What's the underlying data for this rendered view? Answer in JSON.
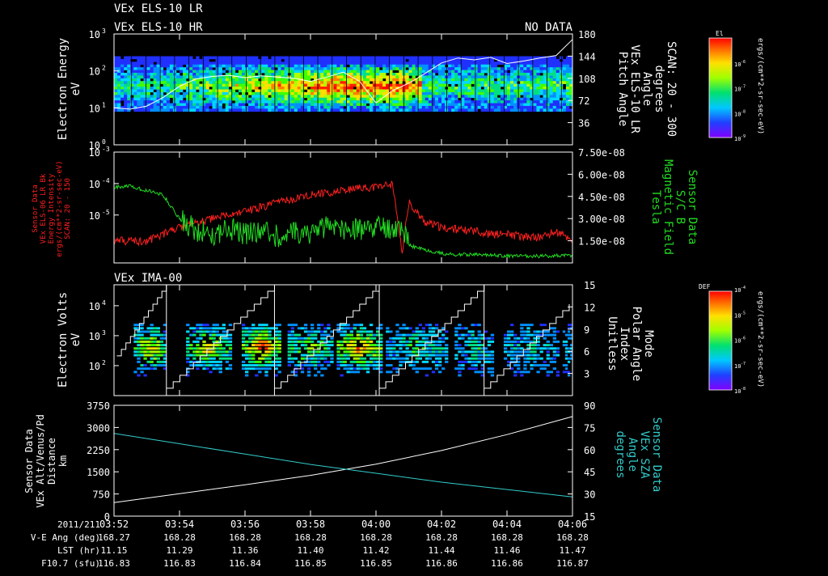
{
  "colors": {
    "background": "#000000",
    "foreground": "#ffffff",
    "red_trace": "#ff2020",
    "green_trace": "#22dd22",
    "cyan_trace": "#33cccc",
    "white_trace": "#ffffff"
  },
  "chart_data": [
    {
      "type": "heatmap",
      "titles": [
        "VEx ELS-10 LR",
        "VEx ELS-10 HR"
      ],
      "annotation": "NO DATA",
      "ylabel": [
        "Electron Energy",
        "eV"
      ],
      "y_scale": "log",
      "ylim": [
        1,
        1000
      ],
      "y_ticks": [
        {
          "base": "10",
          "exp": "0",
          "value": 1
        },
        {
          "base": "10",
          "exp": "1",
          "value": 10
        },
        {
          "base": "10",
          "exp": "2",
          "value": 100
        },
        {
          "base": "10",
          "exp": "3",
          "value": 1000
        }
      ],
      "y2label": [
        "Pitch Angle",
        "VEx ELS-10 LR",
        "Angle",
        "degrees",
        "SCAN: 20 - 300"
      ],
      "y2lim": [
        0,
        180
      ],
      "y2_ticks": [
        "36",
        "72",
        "108",
        "144",
        "180"
      ],
      "colorbar": {
        "title": "El",
        "unit_label": "ergs/(cm**2-sr-sec-eV)",
        "ticks": [
          {
            "base": "10",
            "exp": "-6"
          },
          {
            "base": "10",
            "exp": "-7"
          },
          {
            "base": "10",
            "exp": "-8"
          },
          {
            "base": "10",
            "exp": "-9"
          }
        ]
      },
      "overlay_series": {
        "axis": "right",
        "t": [
          0,
          0.5,
          1,
          1.5,
          2,
          2.5,
          3,
          3.5,
          4,
          4.5,
          5,
          5.5,
          6,
          6.5,
          7,
          7.5,
          8,
          8.5,
          9,
          9.5,
          10,
          10.5,
          11,
          11.5,
          12,
          12.5,
          13,
          13.5,
          14
        ],
        "values": [
          60,
          58,
          63,
          77,
          95,
          107,
          111,
          113,
          109,
          112,
          110,
          108,
          103,
          110,
          118,
          103,
          68,
          88,
          100,
          116,
          133,
          141,
          138,
          142,
          132,
          136,
          141,
          145,
          171
        ]
      }
    },
    {
      "type": "line",
      "ylabel": [
        "Sensor Data",
        "VEx ELS-06 LR Bk",
        "Energy Intensity",
        "ergs/(cm**2-sr-sec-eV)",
        "SCAN: 20 - 150"
      ],
      "y_scale": "log",
      "ylim": [
        3e-07,
        0.001
      ],
      "y_ticks": [
        {
          "base": "10",
          "exp": "-3",
          "value": 0.001
        },
        {
          "base": "10",
          "exp": "-4",
          "value": 0.0001
        },
        {
          "base": "10",
          "exp": "-5",
          "value": 1e-05
        }
      ],
      "y2label": [
        "Sensor Data",
        "S/C B",
        "Magnetic Field",
        "Tesla"
      ],
      "y2lim": [
        0,
        7.5e-08
      ],
      "y2_ticks": [
        "1.50e-08",
        "3.00e-08",
        "4.50e-08",
        "6.00e-08",
        "7.50e-08"
      ],
      "series": [
        {
          "axis": "left",
          "t": [
            0,
            0.5,
            1,
            1.5,
            2,
            2.5,
            3,
            3.5,
            4,
            4.5,
            5,
            5.5,
            6,
            6.5,
            7,
            7.5,
            8,
            8.5,
            8.8,
            9,
            9.5,
            10,
            10.5,
            11,
            11.5,
            12,
            12.5,
            13,
            13.5,
            14
          ],
          "values": [
            1.5e-06,
            1.5e-06,
            1.5e-06,
            2.5e-06,
            4e-06,
            5.5e-06,
            7.5e-06,
            1e-05,
            1.3e-05,
            1.8e-05,
            2.5e-05,
            3.2e-05,
            4.5e-05,
            5e-05,
            6e-05,
            7e-05,
            8e-05,
            9.5e-05,
            6e-07,
            2.5e-05,
            6e-06,
            4e-06,
            3.5e-06,
            3e-06,
            2.5e-06,
            2.5e-06,
            2e-06,
            2e-06,
            3e-06,
            1.6e-06
          ]
        },
        {
          "axis": "right",
          "t": [
            0,
            0.5,
            1,
            1.2,
            1.5,
            2,
            2.5,
            3,
            3.5,
            4,
            4.5,
            5,
            5.5,
            6,
            6.5,
            7,
            7.5,
            8,
            8.5,
            8.8,
            9,
            9.5,
            10,
            10.5,
            11,
            11.5,
            12,
            12.5,
            13,
            13.5,
            14
          ],
          "values": [
            5.1e-08,
            5.2e-08,
            4.9e-08,
            4.8e-08,
            4.6e-08,
            3e-08,
            2.2e-08,
            1.9e-08,
            2.3e-08,
            2e-08,
            2.2e-08,
            1.8e-08,
            2e-08,
            2.1e-08,
            2.4e-08,
            2.3e-08,
            2.2e-08,
            2.6e-08,
            2.4e-08,
            2.6e-08,
            1.2e-08,
            9e-09,
            6.5e-09,
            5.5e-09,
            5.5e-09,
            5e-09,
            5e-09,
            4.5e-09,
            4.5e-09,
            5e-09,
            5e-09
          ]
        }
      ]
    },
    {
      "type": "heatmap",
      "titles": [
        "VEx IMA-00"
      ],
      "ylabel": [
        "Electron Volts",
        "eV"
      ],
      "y_scale": "log",
      "ylim": [
        10,
        50000
      ],
      "y_ticks": [
        {
          "base": "10",
          "exp": "2",
          "value": 100
        },
        {
          "base": "10",
          "exp": "3",
          "value": 1000
        },
        {
          "base": "10",
          "exp": "4",
          "value": 10000
        }
      ],
      "y2label": [
        "Mode",
        "Polar Angle",
        "Index",
        "Unitless"
      ],
      "y2lim": [
        0,
        15
      ],
      "y2_ticks": [
        "3",
        "6",
        "9",
        "12",
        "15"
      ],
      "colorbar": {
        "title": "DEF",
        "unit_label": "ergs/(cm**2-sr-sec-eV)",
        "ticks": [
          {
            "base": "10",
            "exp": "-4"
          },
          {
            "base": "10",
            "exp": "-5"
          },
          {
            "base": "10",
            "exp": "-6"
          },
          {
            "base": "10",
            "exp": "-7"
          },
          {
            "base": "10",
            "exp": "-8"
          }
        ]
      },
      "mode_markers_t": [
        1.6,
        4.9,
        8.1,
        11.3
      ]
    },
    {
      "type": "line",
      "ylabel": [
        "Sensor Data",
        "VEx Alt/Venus/Pd",
        "Distance",
        "km"
      ],
      "ylim": [
        0,
        3750
      ],
      "y_ticks": [
        "0",
        "750",
        "1500",
        "2250",
        "3000",
        "3750"
      ],
      "y2label": [
        "Sensor Data",
        "VEx SZA",
        "Angle",
        "degrees"
      ],
      "y2lim": [
        15,
        90
      ],
      "y2_ticks": [
        "15",
        "30",
        "45",
        "60",
        "75",
        "90"
      ],
      "series": [
        {
          "axis": "left",
          "t": [
            0,
            2,
            4,
            6,
            8,
            10,
            12,
            14
          ],
          "values": [
            460,
            760,
            1060,
            1380,
            1760,
            2220,
            2760,
            3370
          ]
        },
        {
          "axis": "right",
          "t": [
            0,
            2,
            4,
            6,
            8,
            10,
            12,
            14
          ],
          "values": [
            71,
            64,
            57,
            50,
            44,
            38,
            33,
            28
          ]
        }
      ]
    }
  ],
  "time_axis": {
    "labels": [
      "03:52",
      "03:54",
      "03:56",
      "03:58",
      "04:00",
      "04:02",
      "04:04",
      "04:06"
    ],
    "rows": [
      {
        "label": "2011/211",
        "values": []
      },
      {
        "label": "V-E Ang (deg)",
        "values": [
          "168.27",
          "168.28",
          "168.28",
          "168.28",
          "168.28",
          "168.28",
          "168.28",
          "168.28"
        ]
      },
      {
        "label": "LST (hr)",
        "values": [
          "11.15",
          "11.29",
          "11.36",
          "11.40",
          "11.42",
          "11.44",
          "11.46",
          "11.47"
        ]
      },
      {
        "label": "F10.7 (sfu)",
        "values": [
          "116.83",
          "116.83",
          "116.84",
          "116.85",
          "116.85",
          "116.86",
          "116.86",
          "116.87"
        ]
      }
    ]
  }
}
